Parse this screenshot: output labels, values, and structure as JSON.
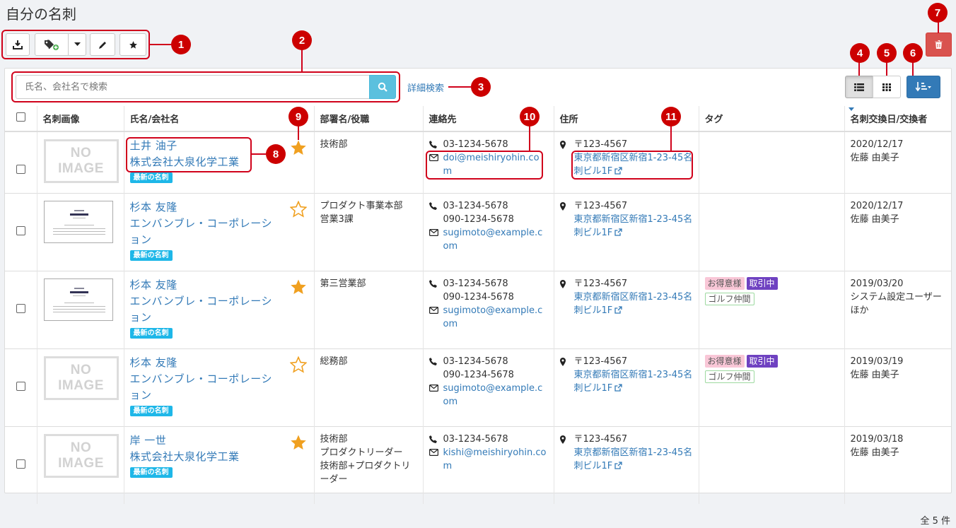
{
  "page": {
    "title": "自分の名刺",
    "total": "全 5 件"
  },
  "search": {
    "placeholder": "氏名、会社名で検索",
    "advanced": "詳細検索"
  },
  "headers": {
    "image": "名刺画像",
    "name": "氏名/会社名",
    "dept": "部署名/役職",
    "contact": "連絡先",
    "address": "住所",
    "tags": "タグ",
    "date": "名刺交換日/交換者"
  },
  "badge": "最新の名刺",
  "no_image": [
    "NO",
    "IMAGE"
  ],
  "rows": [
    {
      "image": "none",
      "name": "土井 油子",
      "company": "株式会社大泉化学工業",
      "favorite": true,
      "dept": [
        "技術部"
      ],
      "phones": [
        "03-1234-5678"
      ],
      "email": "doi@meishiryohin.com",
      "postal": "〒123-4567",
      "address": "東京都新宿区新宿1-23-45名刺ビル1F",
      "tags": [],
      "date": "2020/12/17",
      "exchanger": "佐藤 由美子"
    },
    {
      "image": "card",
      "name": "杉本 友隆",
      "company": "エンバンブレ・コーポレーション",
      "favorite": false,
      "dept": [
        "プロダクト事業本部　営業3課"
      ],
      "phones": [
        "03-1234-5678",
        "090-1234-5678"
      ],
      "email": "sugimoto@example.com",
      "postal": "〒123-4567",
      "address": "東京都新宿区新宿1-23-45名刺ビル1F",
      "tags": [],
      "date": "2020/12/17",
      "exchanger": "佐藤 由美子"
    },
    {
      "image": "card",
      "name": "杉本 友隆",
      "company": "エンバンブレ・コーポレーション",
      "favorite": true,
      "dept": [
        "第三営業部"
      ],
      "phones": [
        "03-1234-5678",
        "090-1234-5678"
      ],
      "email": "sugimoto@example.com",
      "postal": "〒123-4567",
      "address": "東京都新宿区新宿1-23-45名刺ビル1F",
      "tags": [
        "お得意様",
        "取引中",
        "ゴルフ仲間"
      ],
      "date": "2019/03/20",
      "exchanger": "システム設定ユーザーほか"
    },
    {
      "image": "none",
      "name": "杉本 友隆",
      "company": "エンバンブレ・コーポレーション",
      "favorite": false,
      "dept": [
        "総務部"
      ],
      "phones": [
        "03-1234-5678",
        "090-1234-5678"
      ],
      "email": "sugimoto@example.com",
      "postal": "〒123-4567",
      "address": "東京都新宿区新宿1-23-45名刺ビル1F",
      "tags": [
        "お得意様",
        "取引中",
        "ゴルフ仲間"
      ],
      "date": "2019/03/19",
      "exchanger": "佐藤 由美子"
    },
    {
      "image": "none",
      "name": "岸 一世",
      "company": "株式会社大泉化学工業",
      "favorite": true,
      "dept": [
        "技術部",
        "プロダクトリーダー",
        "技術部+プロダクトリーダー"
      ],
      "phones": [
        "03-1234-5678"
      ],
      "email": "kishi@meishiryohin.com",
      "postal": "〒123-4567",
      "address": "東京都新宿区新宿1-23-45名刺ビル1F",
      "tags": [],
      "date": "2019/03/18",
      "exchanger": "佐藤 由美子"
    }
  ],
  "callouts": [
    "1",
    "2",
    "3",
    "4",
    "5",
    "6",
    "7",
    "8",
    "9",
    "10",
    "11"
  ],
  "colors": {
    "accent": "#337ab7",
    "callout": "#cc0000",
    "badge": "#1eb7e8",
    "star": "#f0a020",
    "delete": "#d9534f"
  }
}
